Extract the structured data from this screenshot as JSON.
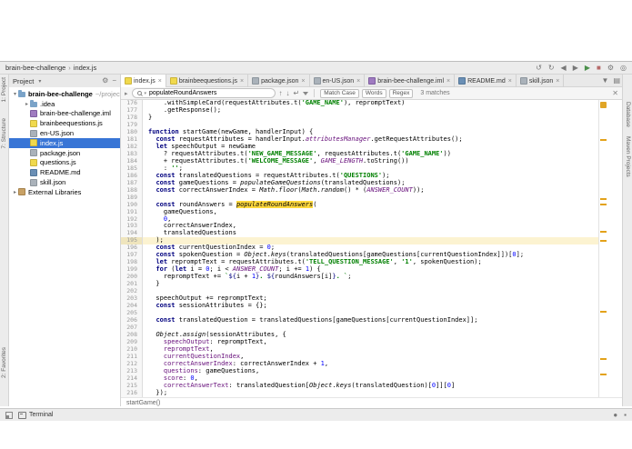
{
  "colors": {
    "accent": "#3875d6",
    "match_highlight": "#ffd93e",
    "warning": "#e0a526"
  },
  "window_title": {
    "project": "brain-bee-challenge",
    "separator": "›",
    "file": "index.js"
  },
  "toolbar_icons": [
    {
      "name": "undo-icon",
      "glyph": "↺"
    },
    {
      "name": "redo-icon",
      "glyph": "↻"
    },
    {
      "name": "back-icon",
      "glyph": "◀"
    },
    {
      "name": "forward-icon",
      "glyph": "▶"
    },
    {
      "name": "run-icon",
      "glyph": "▶",
      "color": "#4a8f4a"
    },
    {
      "name": "stop-icon",
      "glyph": "■",
      "color": "#b66a6a"
    },
    {
      "name": "settings-icon",
      "glyph": "⚙"
    },
    {
      "name": "search-everywhere-icon",
      "glyph": "◎"
    }
  ],
  "tabrow_icons": [
    {
      "name": "hidden-tabs-icon",
      "glyph": "▼"
    },
    {
      "name": "editor-layout-icon",
      "glyph": "▤"
    }
  ],
  "left_strip": {
    "top": [
      "1: Project",
      "7: Structure"
    ],
    "bottom": [
      "2: Favorites"
    ]
  },
  "right_strip": [
    "Database",
    "Maven Projects"
  ],
  "project_panel": {
    "header": {
      "title": "Project",
      "chevron": "▾"
    },
    "header_icons": [
      {
        "name": "settings-icon",
        "glyph": "⚙"
      },
      {
        "name": "hide-panel-icon",
        "glyph": "−"
      }
    ],
    "tree": [
      {
        "label": "brain-bee-challenge",
        "path": "~/projects/brain-bee-challenge",
        "icon": "folder",
        "level": 0,
        "arrow": true,
        "expanded": true,
        "bold": true
      },
      {
        "label": ".idea",
        "icon": "folder",
        "level": 1,
        "arrow": true,
        "expanded": false
      },
      {
        "label": "brain-bee-challenge.iml",
        "icon": "iml",
        "level": 1,
        "arrow": false
      },
      {
        "label": "brainbeequestions.js",
        "icon": "js",
        "level": 1,
        "arrow": false
      },
      {
        "label": "en-US.json",
        "icon": "json",
        "level": 1,
        "arrow": false
      },
      {
        "label": "index.js",
        "icon": "js",
        "level": 1,
        "arrow": false,
        "selected": true
      },
      {
        "label": "package.json",
        "icon": "json",
        "level": 1,
        "arrow": false
      },
      {
        "label": "questions.js",
        "icon": "js",
        "level": 1,
        "arrow": false
      },
      {
        "label": "README.md",
        "icon": "md",
        "level": 1,
        "arrow": false
      },
      {
        "label": "skill.json",
        "icon": "json",
        "level": 1,
        "arrow": false
      },
      {
        "label": "External Libraries",
        "icon": "lib",
        "level": 0,
        "arrow": true,
        "expanded": false
      }
    ]
  },
  "tabs": [
    {
      "label": "index.js",
      "icon": "js",
      "active": true
    },
    {
      "label": "brainbeequestions.js",
      "icon": "js",
      "active": false
    },
    {
      "label": "package.json",
      "icon": "json",
      "active": false
    },
    {
      "label": "en-US.json",
      "icon": "json",
      "active": false
    },
    {
      "label": "brain-bee-challenge.iml",
      "icon": "iml",
      "active": false
    },
    {
      "label": "README.md",
      "icon": "md",
      "active": false
    },
    {
      "label": "skill.json",
      "icon": "json",
      "active": false
    }
  ],
  "find_bar": {
    "query": "populateRoundAnswers",
    "icons": [
      {
        "name": "previous-occurrence-icon",
        "glyph": "↑"
      },
      {
        "name": "next-occurrence-icon",
        "glyph": "↓"
      },
      {
        "name": "find-enter-icon",
        "glyph": "↵"
      }
    ],
    "toggles": [
      "Match Case",
      "Words",
      "Regex"
    ],
    "matches": "3 matches",
    "close": "✕"
  },
  "breadcrumb": "startGame()",
  "status_bar": {
    "terminal_label": "Terminal",
    "right_icons": [
      {
        "name": "notifications-icon",
        "glyph": "●"
      },
      {
        "name": "indicator-icon",
        "glyph": "▪"
      }
    ]
  },
  "editor": {
    "current_line": 195,
    "stripe_marks": [
      0.13,
      0.33,
      0.35,
      0.44,
      0.47,
      0.71,
      0.87,
      0.92
    ],
    "lines": [
      {
        "n": 176,
        "s": [
          [
            "p",
            "    .withSimpleCard(requestAttributes.t("
          ],
          [
            "s",
            "'GAME_NAME'"
          ],
          [
            "p",
            "), repromptText)"
          ]
        ]
      },
      {
        "n": 177,
        "s": [
          [
            "p",
            "    .getResponse();"
          ]
        ]
      },
      {
        "n": 178,
        "s": [
          [
            "p",
            "}"
          ]
        ]
      },
      {
        "n": 179,
        "s": []
      },
      {
        "n": 180,
        "s": [
          [
            "k",
            "function"
          ],
          [
            "p",
            " startGame(newGame, handlerInput) {"
          ]
        ]
      },
      {
        "n": 181,
        "s": [
          [
            "p",
            "  "
          ],
          [
            "k",
            "const"
          ],
          [
            "p",
            " requestAttributes = handlerInput."
          ],
          [
            "f",
            "attributesManager"
          ],
          [
            "p",
            ".getRequestAttributes();"
          ]
        ]
      },
      {
        "n": 182,
        "s": [
          [
            "p",
            "  "
          ],
          [
            "k",
            "let"
          ],
          [
            "p",
            " speechOutput = newGame"
          ]
        ]
      },
      {
        "n": 183,
        "s": [
          [
            "p",
            "    ? requestAttributes.t("
          ],
          [
            "s",
            "'NEW_GAME_MESSAGE'"
          ],
          [
            "p",
            ", requestAttributes.t("
          ],
          [
            "s",
            "'GAME_NAME'"
          ],
          [
            "p",
            "))"
          ]
        ]
      },
      {
        "n": 184,
        "s": [
          [
            "p",
            "    + requestAttributes.t("
          ],
          [
            "s",
            "'WELCOME_MESSAGE'"
          ],
          [
            "p",
            ", "
          ],
          [
            "f",
            "GAME_LENGTH"
          ],
          [
            "p",
            ".toString())"
          ]
        ]
      },
      {
        "n": 185,
        "s": [
          [
            "p",
            "    : "
          ],
          [
            "s",
            "''"
          ],
          [
            "p",
            ";"
          ]
        ]
      },
      {
        "n": 186,
        "s": [
          [
            "p",
            "  "
          ],
          [
            "k",
            "const"
          ],
          [
            "p",
            " translatedQuestions = requestAttributes.t("
          ],
          [
            "s",
            "'QUESTIONS'"
          ],
          [
            "p",
            ");"
          ]
        ]
      },
      {
        "n": 187,
        "s": [
          [
            "p",
            "  "
          ],
          [
            "k",
            "const"
          ],
          [
            "p",
            " gameQuestions = "
          ],
          [
            "it",
            "populateGameQuestions"
          ],
          [
            "p",
            "(translatedQuestions);"
          ]
        ]
      },
      {
        "n": 188,
        "s": [
          [
            "p",
            "  "
          ],
          [
            "k",
            "const"
          ],
          [
            "p",
            " correctAnswerIndex = "
          ],
          [
            "it",
            "Math"
          ],
          [
            "p",
            "."
          ],
          [
            "it",
            "floor"
          ],
          [
            "p",
            "("
          ],
          [
            "it",
            "Math"
          ],
          [
            "p",
            "."
          ],
          [
            "it",
            "random"
          ],
          [
            "p",
            "() * ("
          ],
          [
            "f",
            "ANSWER_COUNT"
          ],
          [
            "p",
            "));"
          ]
        ]
      },
      {
        "n": 189,
        "s": []
      },
      {
        "n": 190,
        "s": [
          [
            "p",
            "  "
          ],
          [
            "k",
            "const"
          ],
          [
            "p",
            " roundAnswers = "
          ],
          [
            "hl",
            "populateRoundAnswers"
          ],
          [
            "p",
            "("
          ]
        ]
      },
      {
        "n": 191,
        "s": [
          [
            "p",
            "    gameQuestions,"
          ]
        ]
      },
      {
        "n": 192,
        "s": [
          [
            "p",
            "    "
          ],
          [
            "n",
            "0"
          ],
          [
            "p",
            ","
          ]
        ]
      },
      {
        "n": 193,
        "s": [
          [
            "p",
            "    correctAnswerIndex,"
          ]
        ]
      },
      {
        "n": 194,
        "s": [
          [
            "p",
            "    translatedQuestions"
          ]
        ]
      },
      {
        "n": 195,
        "s": [
          [
            "p",
            "  );"
          ]
        ]
      },
      {
        "n": 196,
        "s": [
          [
            "p",
            "  "
          ],
          [
            "k",
            "const"
          ],
          [
            "p",
            " currentQuestionIndex = "
          ],
          [
            "n",
            "0"
          ],
          [
            "p",
            ";"
          ]
        ]
      },
      {
        "n": 197,
        "s": [
          [
            "p",
            "  "
          ],
          [
            "k",
            "const"
          ],
          [
            "p",
            " spokenQuestion = "
          ],
          [
            "it",
            "Object"
          ],
          [
            "p",
            "."
          ],
          [
            "it",
            "keys"
          ],
          [
            "p",
            "(translatedQuestions[gameQuestions[currentQuestionIndex]])["
          ],
          [
            "n",
            "0"
          ],
          [
            "p",
            "];"
          ]
        ]
      },
      {
        "n": 198,
        "s": [
          [
            "p",
            "  "
          ],
          [
            "k",
            "let"
          ],
          [
            "p",
            " repromptText = requestAttributes.t("
          ],
          [
            "s",
            "'TELL_QUESTION_MESSAGE'"
          ],
          [
            "p",
            ", "
          ],
          [
            "s",
            "'1'"
          ],
          [
            "p",
            ", spokenQuestion);"
          ]
        ]
      },
      {
        "n": 199,
        "s": [
          [
            "p",
            "  "
          ],
          [
            "k",
            "for"
          ],
          [
            "p",
            " ("
          ],
          [
            "k",
            "let"
          ],
          [
            "p",
            " i = "
          ],
          [
            "n",
            "0"
          ],
          [
            "p",
            "; i < "
          ],
          [
            "f",
            "ANSWER_COUNT"
          ],
          [
            "p",
            "; i += "
          ],
          [
            "n",
            "1"
          ],
          [
            "p",
            ") {"
          ]
        ]
      },
      {
        "n": 200,
        "s": [
          [
            "p",
            "    repromptText += "
          ],
          [
            "s",
            "`"
          ],
          [
            "x",
            "${"
          ],
          [
            "p",
            "i + "
          ],
          [
            "n",
            "1"
          ],
          [
            "x",
            "}"
          ],
          [
            "s",
            ". "
          ],
          [
            "x",
            "${"
          ],
          [
            "p",
            "roundAnswers[i]"
          ],
          [
            "x",
            "}"
          ],
          [
            "s",
            ". `"
          ],
          [
            "p",
            ";"
          ]
        ]
      },
      {
        "n": 201,
        "s": [
          [
            "p",
            "  }"
          ]
        ]
      },
      {
        "n": 202,
        "s": []
      },
      {
        "n": 203,
        "s": [
          [
            "p",
            "  speechOutput += repromptText;"
          ]
        ]
      },
      {
        "n": 204,
        "s": [
          [
            "p",
            "  "
          ],
          [
            "k",
            "const"
          ],
          [
            "p",
            " sessionAttributes = {};"
          ]
        ]
      },
      {
        "n": 205,
        "s": []
      },
      {
        "n": 206,
        "s": [
          [
            "p",
            "  "
          ],
          [
            "k",
            "const"
          ],
          [
            "p",
            " translatedQuestion = translatedQuestions[gameQuestions[currentQuestionIndex]];"
          ]
        ]
      },
      {
        "n": 207,
        "s": []
      },
      {
        "n": 208,
        "s": [
          [
            "p",
            "  "
          ],
          [
            "it",
            "Object"
          ],
          [
            "p",
            "."
          ],
          [
            "it",
            "assign"
          ],
          [
            "p",
            "(sessionAttributes, {"
          ]
        ]
      },
      {
        "n": 209,
        "s": [
          [
            "p",
            "    "
          ],
          [
            "pk",
            "speechOutput"
          ],
          [
            "p",
            ": repromptText,"
          ]
        ]
      },
      {
        "n": 210,
        "s": [
          [
            "p",
            "    "
          ],
          [
            "pk",
            "repromptText"
          ],
          [
            "p",
            ","
          ]
        ]
      },
      {
        "n": 211,
        "s": [
          [
            "p",
            "    "
          ],
          [
            "pk",
            "currentQuestionIndex"
          ],
          [
            "p",
            ","
          ]
        ]
      },
      {
        "n": 212,
        "s": [
          [
            "p",
            "    "
          ],
          [
            "pk",
            "correctAnswerIndex"
          ],
          [
            "p",
            ": correctAnswerIndex + "
          ],
          [
            "n",
            "1"
          ],
          [
            "p",
            ","
          ]
        ]
      },
      {
        "n": 213,
        "s": [
          [
            "p",
            "    "
          ],
          [
            "pk",
            "questions"
          ],
          [
            "p",
            ": gameQuestions,"
          ]
        ]
      },
      {
        "n": 214,
        "s": [
          [
            "p",
            "    "
          ],
          [
            "pk",
            "score"
          ],
          [
            "p",
            ": "
          ],
          [
            "n",
            "0"
          ],
          [
            "p",
            ","
          ]
        ]
      },
      {
        "n": 215,
        "s": [
          [
            "p",
            "    "
          ],
          [
            "pk",
            "correctAnswerText"
          ],
          [
            "p",
            ": translatedQuestion["
          ],
          [
            "it",
            "Object"
          ],
          [
            "p",
            "."
          ],
          [
            "it",
            "keys"
          ],
          [
            "p",
            "(translatedQuestion)["
          ],
          [
            "n",
            "0"
          ],
          [
            "p",
            "]]["
          ],
          [
            "n",
            "0"
          ],
          [
            "p",
            "]"
          ]
        ]
      },
      {
        "n": 216,
        "s": [
          [
            "p",
            "  });"
          ]
        ]
      }
    ]
  }
}
